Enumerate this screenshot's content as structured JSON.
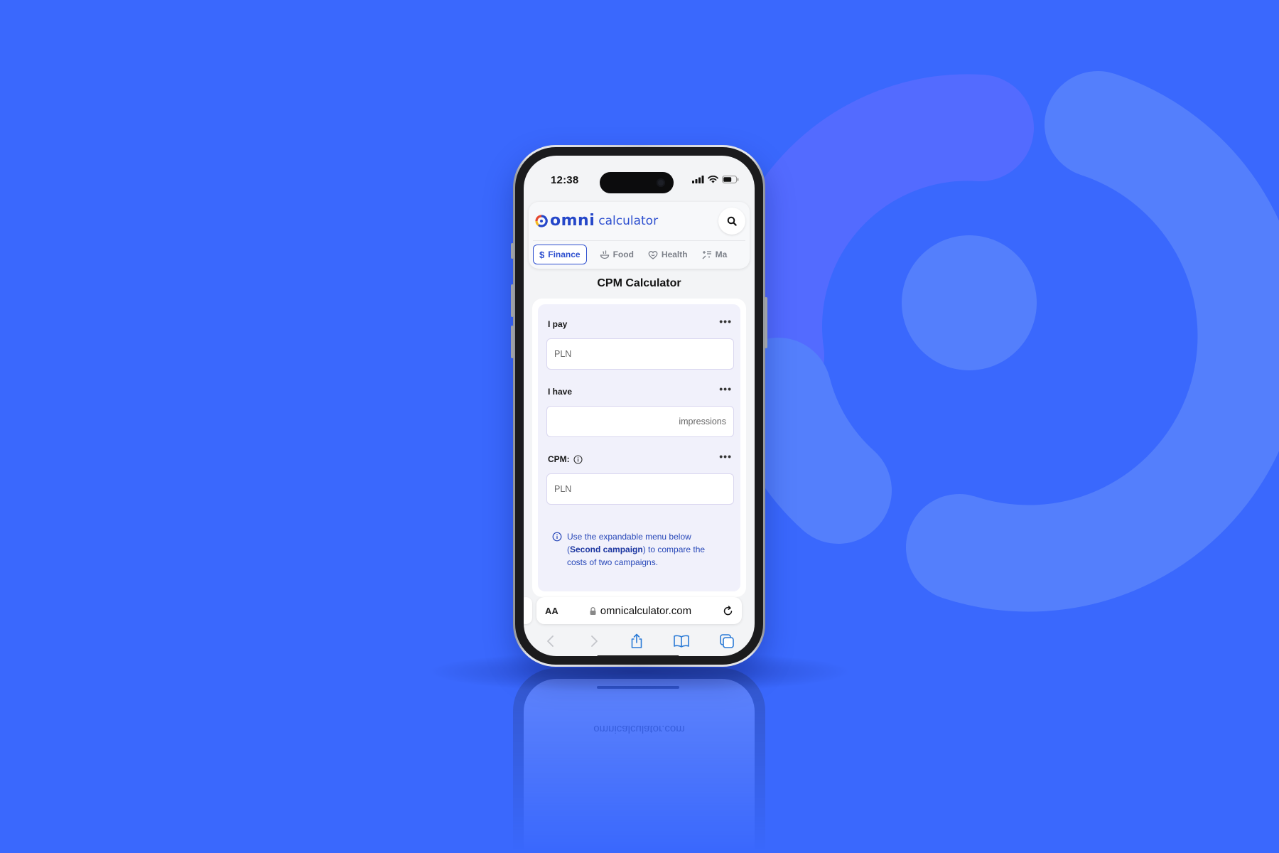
{
  "colors": {
    "background": "#3a68fd",
    "brand_blue": "#2d4fcf",
    "accent_red": "#e5482f",
    "accent_yellow": "#f5b922"
  },
  "status_bar": {
    "time": "12:38",
    "icons": [
      "signal-icon",
      "wifi-icon",
      "battery-icon"
    ]
  },
  "header": {
    "logo_word": "omni",
    "logo_sub": "calculator",
    "search_icon": "search-icon"
  },
  "categories": [
    {
      "label": "Finance",
      "icon": "dollar-icon",
      "active": true
    },
    {
      "label": "Food",
      "icon": "bowl-icon",
      "active": false
    },
    {
      "label": "Health",
      "icon": "heart-icon",
      "active": false
    },
    {
      "label": "Ma",
      "icon": "math-icon",
      "active": false
    }
  ],
  "page": {
    "title": "CPM Calculator"
  },
  "fields": [
    {
      "label": "I pay",
      "value": "",
      "unit": "PLN",
      "unit_align": "left",
      "has_info": false
    },
    {
      "label": "I have",
      "value": "",
      "unit": "impressions",
      "unit_align": "right",
      "has_info": false
    },
    {
      "label": "CPM:",
      "value": "",
      "unit": "PLN",
      "unit_align": "left",
      "has_info": true
    }
  ],
  "info_note": {
    "prefix": "Use the expandable menu below (",
    "bold": "Second campaign",
    "suffix": ") to compare the costs of two campaigns."
  },
  "browser": {
    "text_size_label": "AA",
    "url": "omnicalculator.com",
    "nav_icons": [
      "back-icon",
      "forward-icon",
      "share-icon",
      "bookmarks-icon",
      "tabs-icon"
    ]
  },
  "reflection": {
    "url": "omnicalculator.com"
  }
}
